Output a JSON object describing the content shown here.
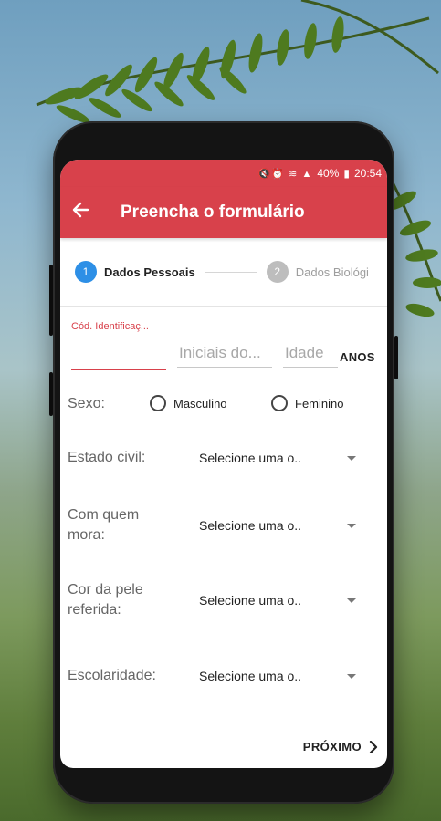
{
  "status_bar": {
    "icons": "🔇⏰ ≋ ▲",
    "battery": "40%",
    "time": "20:54"
  },
  "app_bar": {
    "title": "Preencha o formulário",
    "back_icon": "arrow-back-icon"
  },
  "stepper": {
    "steps": [
      {
        "number": "1",
        "label": "Dados Pessoais",
        "active": true
      },
      {
        "number": "2",
        "label": "Dados Biológi",
        "active": false
      }
    ]
  },
  "form": {
    "code_label": "Cód. Identificaç...",
    "code_value": "",
    "initials_placeholder": "Iniciais do...",
    "age_placeholder": "Idade",
    "age_unit": "ANOS",
    "sexo": {
      "label": "Sexo:",
      "options": [
        "Masculino",
        "Feminino"
      ]
    },
    "estado_civil": {
      "label": "Estado civil:",
      "value": "Selecione uma o.."
    },
    "com_quem_mora": {
      "label_line1": "Com quem",
      "label_line2": "mora:",
      "value": "Selecione uma o.."
    },
    "cor_da_pele": {
      "label_line1": "Cor da pele",
      "label_line2": "referida:",
      "value": "Selecione uma o.."
    },
    "escolaridade": {
      "label": "Escolaridade:",
      "value": "Selecione uma o.."
    }
  },
  "footer": {
    "next_label": "PRÓXIMO"
  },
  "colors": {
    "primary": "#d8414b",
    "accent": "#2d8fe6"
  }
}
